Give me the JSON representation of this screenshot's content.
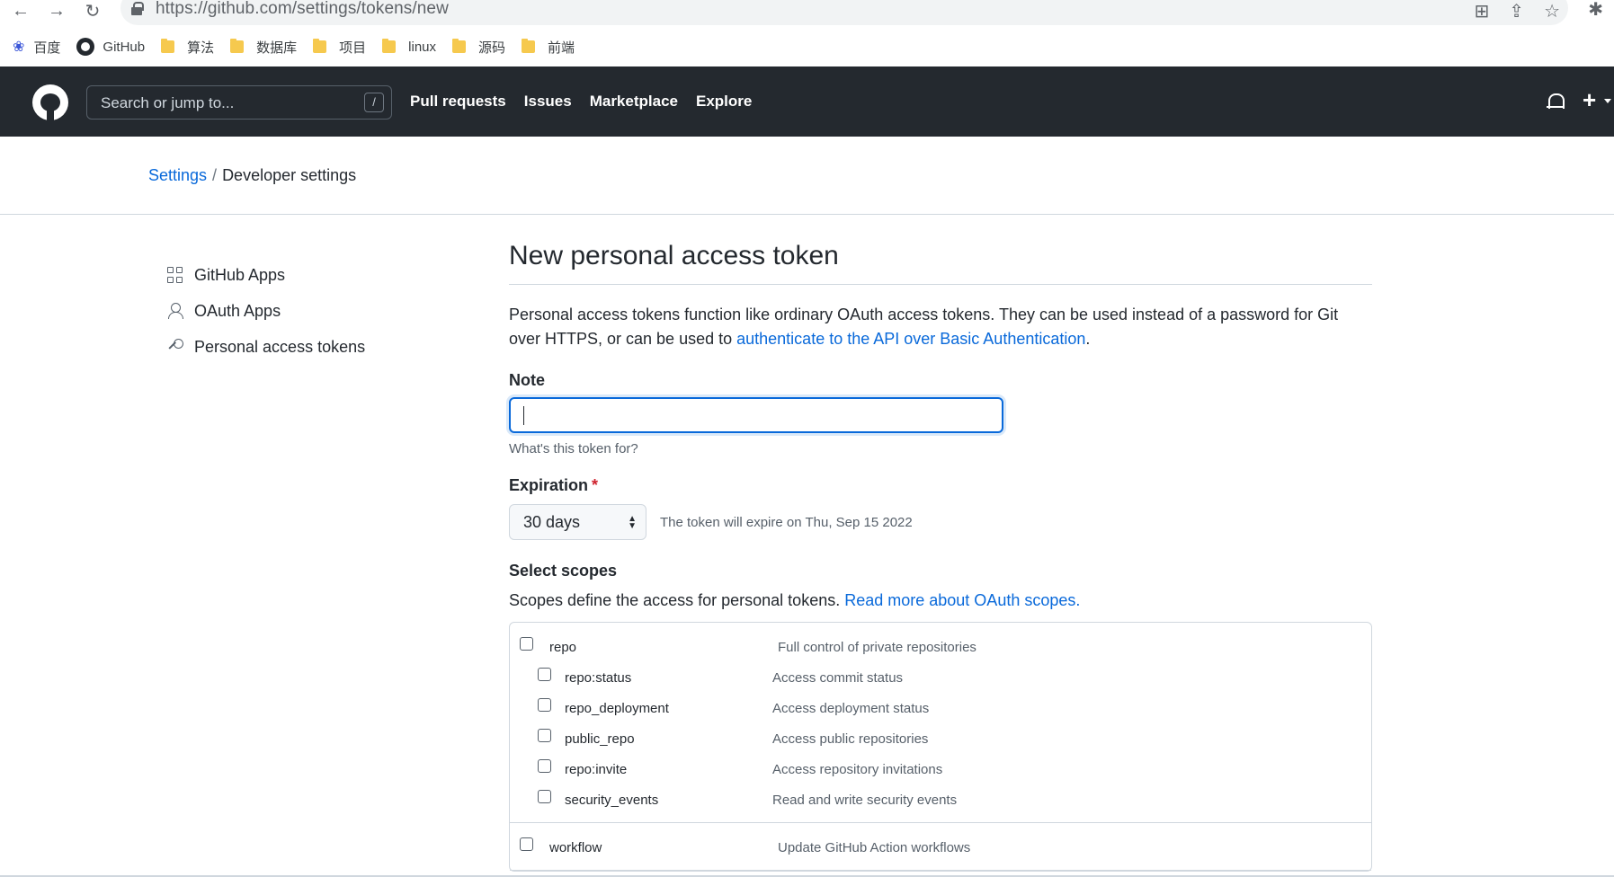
{
  "browser": {
    "url": "https://github.com/settings/tokens/new",
    "bookmarks": [
      "百度",
      "GitHub",
      "算法",
      "数据库",
      "项目",
      "linux",
      "源码",
      "前端"
    ]
  },
  "header": {
    "search_placeholder": "Search or jump to...",
    "search_shortcut": "/",
    "nav": [
      "Pull requests",
      "Issues",
      "Marketplace",
      "Explore"
    ]
  },
  "breadcrumb": {
    "settings": "Settings",
    "separator": "/",
    "current": "Developer settings"
  },
  "sidebar": {
    "items": [
      {
        "label": "GitHub Apps",
        "icon": "apps-icon"
      },
      {
        "label": "OAuth Apps",
        "icon": "person-icon"
      },
      {
        "label": "Personal access tokens",
        "icon": "key-icon"
      }
    ]
  },
  "main": {
    "title": "New personal access token",
    "intro_text": "Personal access tokens function like ordinary OAuth access tokens. They can be used instead of a password for Git over HTTPS, or can be used to ",
    "intro_link": "authenticate to the API over Basic Authentication",
    "intro_end": ".",
    "note_label": "Note",
    "note_value": "",
    "note_hint": "What's this token for?",
    "expiration_label": "Expiration",
    "expiration_required": "*",
    "expiration_value": "30 days",
    "expiration_text": "The token will expire on Thu, Sep 15 2022",
    "scopes_label": "Select scopes",
    "scopes_desc": "Scopes define the access for personal tokens. ",
    "scopes_link": "Read more about OAuth scopes."
  },
  "scopes": [
    {
      "name": "repo",
      "desc": "Full control of private repositories",
      "children": [
        {
          "name": "repo:status",
          "desc": "Access commit status"
        },
        {
          "name": "repo_deployment",
          "desc": "Access deployment status"
        },
        {
          "name": "public_repo",
          "desc": "Access public repositories"
        },
        {
          "name": "repo:invite",
          "desc": "Access repository invitations"
        },
        {
          "name": "security_events",
          "desc": "Read and write security events"
        }
      ]
    },
    {
      "name": "workflow",
      "desc": "Update GitHub Action workflows",
      "children": []
    }
  ],
  "colors": {
    "header_bg": "#24292f",
    "link": "#0969da",
    "focus": "#0969da",
    "required": "#cf222e"
  }
}
